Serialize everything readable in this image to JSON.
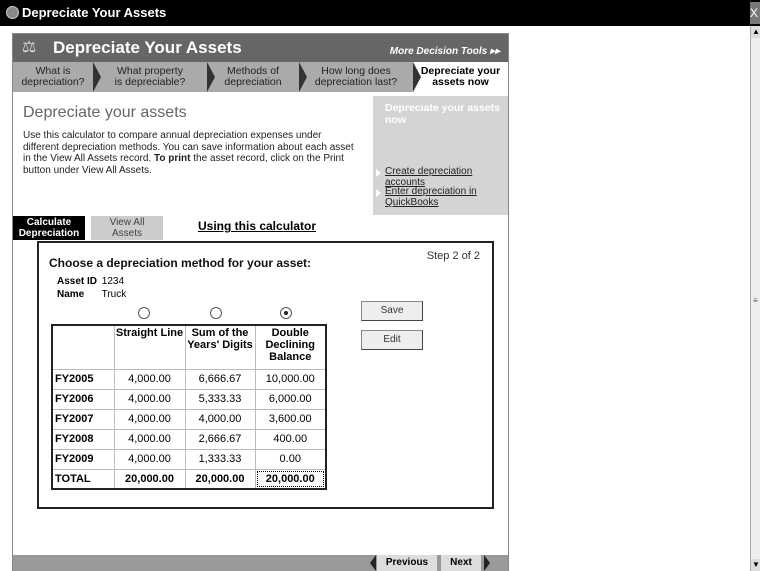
{
  "window": {
    "title": "Depreciate Your Assets",
    "close": "X"
  },
  "header": {
    "title": "Depreciate Your Assets",
    "more_tools": "More Decision Tools"
  },
  "nav": [
    {
      "label1": "What is",
      "label2": "depreciation?"
    },
    {
      "label1": "What property",
      "label2": "is depreciable?"
    },
    {
      "label1": "Methods of",
      "label2": "depreciation"
    },
    {
      "label1": "How long does",
      "label2": "depreciation last?"
    },
    {
      "label1": "Depreciate your",
      "label2": "assets now"
    }
  ],
  "page": {
    "title": "Depreciate your assets",
    "intro_1": "Use this calculator to compare annual depreciation expenses under different depreciation methods. You can save information about each asset in the View All Assets record.",
    "intro_bold": "To print",
    "intro_2": "the asset record, click on the Print button under View All Assets."
  },
  "side": {
    "current": "Depreciate your assets now",
    "link1": "Create depreciation accounts",
    "link2": "Enter depreciation in QuickBooks"
  },
  "tabs": {
    "calc1": "Calculate",
    "calc2": "Depreciation",
    "view1": "View All",
    "view2": "Assets",
    "using": "Using this calculator"
  },
  "card": {
    "step": "Step 2 of 2",
    "heading": "Choose a depreciation method for your asset:",
    "asset_id_label": "Asset ID",
    "asset_id": "1234",
    "name_label": "Name",
    "name": "Truck",
    "selected_method": "Double Declining Balance"
  },
  "table": {
    "headers": [
      "",
      "Straight Line",
      "Sum of the Years' Digits",
      "Double Declining Balance"
    ],
    "rows": [
      [
        "FY2005",
        "4,000.00",
        "6,666.67",
        "10,000.00"
      ],
      [
        "FY2006",
        "4,000.00",
        "5,333.33",
        "6,000.00"
      ],
      [
        "FY2007",
        "4,000.00",
        "4,000.00",
        "3,600.00"
      ],
      [
        "FY2008",
        "4,000.00",
        "2,666.67",
        "400.00"
      ],
      [
        "FY2009",
        "4,000.00",
        "1,333.33",
        "0.00"
      ],
      [
        "TOTAL",
        "20,000.00",
        "20,000.00",
        "20,000.00"
      ]
    ]
  },
  "buttons": {
    "save": "Save",
    "edit": "Edit"
  },
  "footer": {
    "previous": "Previous",
    "next": "Next"
  }
}
